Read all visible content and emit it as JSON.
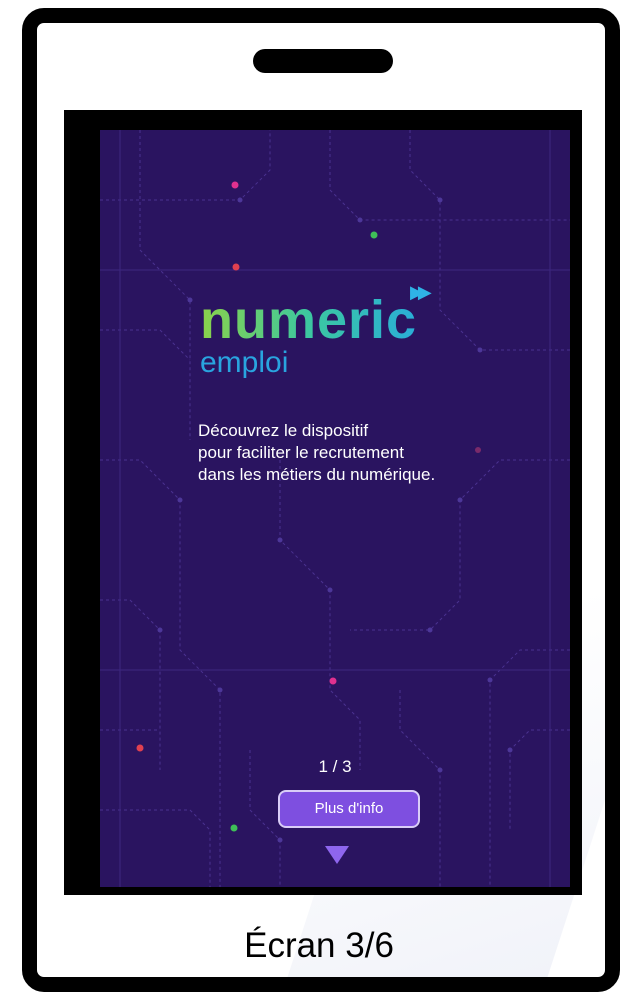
{
  "app": {
    "logo_text": "numeric",
    "logo_subtext": "emploi",
    "logo_icon": "fast-forward-icon",
    "tagline_lines": [
      "Découvrez le dispositif",
      "pour faciliter le recrutement",
      "dans les métiers du numérique."
    ],
    "pager": "1 / 3",
    "more_button_label": "Plus d'info",
    "scroll_icon": "down-triangle-icon"
  },
  "caption": "Écran 3/6",
  "colors": {
    "screen_background": "#2a1460",
    "circuit_lines": "#4a3290",
    "button_fill": "#7e4fe0",
    "logo_gradient_start": "#8bd34a",
    "logo_gradient_end": "#2aaed8",
    "subtext": "#29a4df",
    "dot_pink": "#e0318f",
    "dot_green": "#3fbf58",
    "dot_red": "#e04050"
  }
}
